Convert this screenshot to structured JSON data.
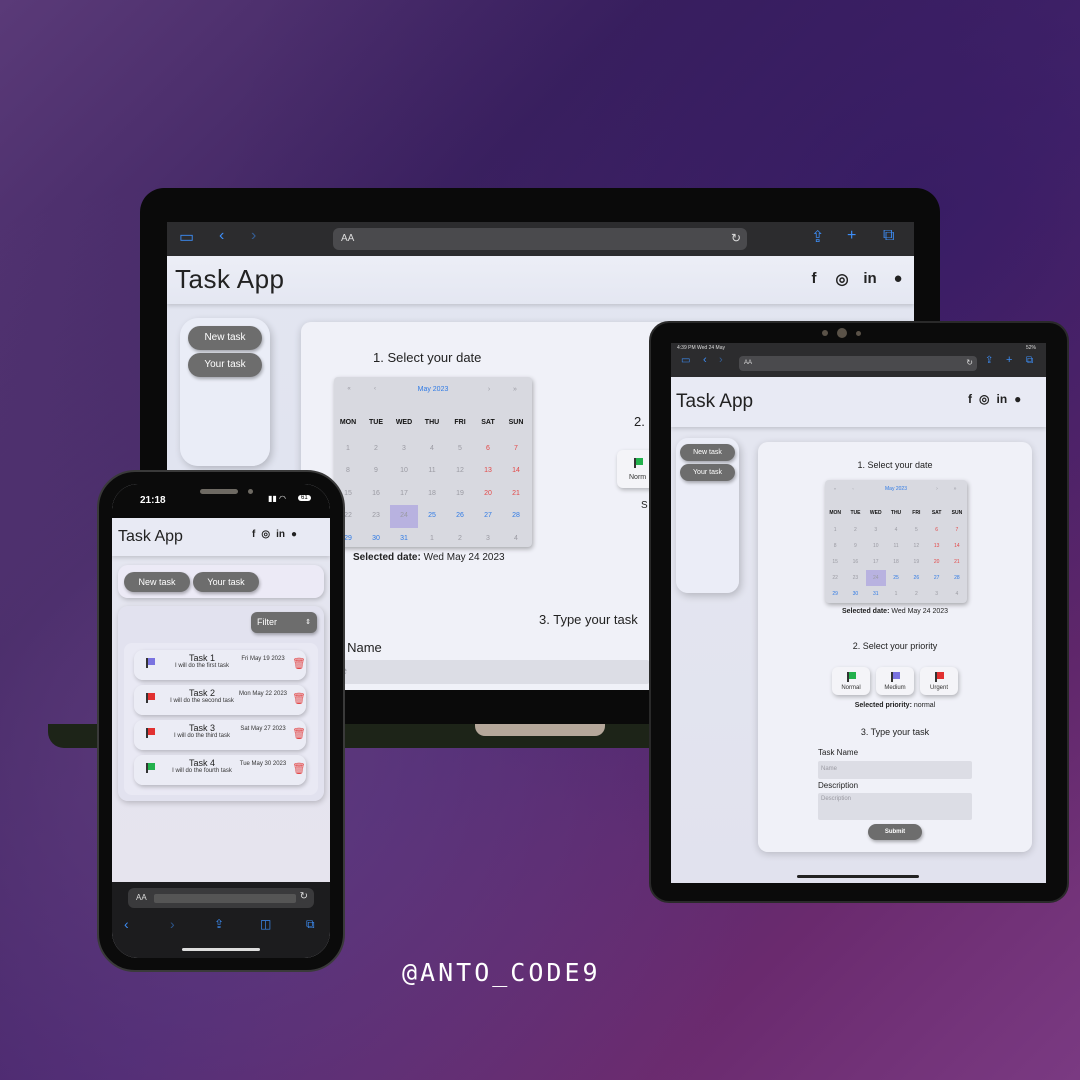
{
  "app": {
    "title": "Task App",
    "social": [
      "f",
      "◎",
      "in",
      "●"
    ],
    "nav": {
      "new_task": "New task",
      "your_task": "Your task"
    }
  },
  "browser": {
    "url_text": "AA"
  },
  "laptop": {
    "step1": "1. Select your date",
    "step2_partial": "2.",
    "step3": "3. Type your task",
    "task_name_label": "k Name",
    "task_name_placeholder": "me",
    "priority_partial": "Norm",
    "partial_s": "S",
    "selected_date_label": "Selected date:",
    "selected_date_value": "Wed May 24 2023"
  },
  "calendar": {
    "nav_prev2": "«",
    "nav_prev": "‹",
    "month": "May 2023",
    "nav_next": "›",
    "nav_next2": "»",
    "headers": [
      "MON",
      "TUE",
      "WED",
      "THU",
      "FRI",
      "SAT",
      "SUN"
    ],
    "weeks": [
      [
        "1",
        "2",
        "3",
        "4",
        "5",
        "6",
        "7"
      ],
      [
        "8",
        "9",
        "10",
        "11",
        "12",
        "13",
        "14"
      ],
      [
        "15",
        "16",
        "17",
        "18",
        "19",
        "20",
        "21"
      ],
      [
        "22",
        "23",
        "24",
        "25",
        "26",
        "27",
        "28"
      ],
      [
        "29",
        "30",
        "31",
        "1",
        "2",
        "3",
        "4"
      ]
    ],
    "selected": "24"
  },
  "tablet": {
    "status_time": "4:39 PM  Wed 24 May",
    "status_right": "52%",
    "step1": "1. Select your date",
    "selected_date_label": "Selected date:",
    "selected_date_value": "Wed May 24 2023",
    "step2": "2. Select your priority",
    "priorities": [
      "Normal",
      "Medium",
      "Urgent"
    ],
    "selected_priority_label": "Selected priority:",
    "selected_priority_value": "normal",
    "step3": "3. Type your task",
    "task_name_label": "Task Name",
    "task_name_placeholder": "Name",
    "description_label": "Description",
    "description_placeholder": "Description",
    "submit": "Submit"
  },
  "phone": {
    "time": "21:18",
    "battery": "61",
    "filter": "Filter",
    "tasks": [
      {
        "title": "Task 1",
        "desc": "I will do the first task",
        "date": "Fri May 19 2023",
        "flag": "#7a73e0"
      },
      {
        "title": "Task 2",
        "desc": "I will do the second task",
        "date": "Mon May 22 2023",
        "flag": "#e23030"
      },
      {
        "title": "Task 3",
        "desc": "I will do the third task",
        "date": "Sat May 27 2023",
        "flag": "#e23030"
      },
      {
        "title": "Task 4",
        "desc": "I will do the fourth task",
        "date": "Tue May 30 2023",
        "flag": "#22b14c"
      }
    ]
  },
  "watermark": "@ANTO_CODE9",
  "colors": {
    "normal_flag": "#22b14c",
    "medium_flag": "#7a73e0",
    "urgent_flag": "#e23030",
    "pill": "#6d6d6d",
    "safari_blue": "#3d8ef7"
  }
}
